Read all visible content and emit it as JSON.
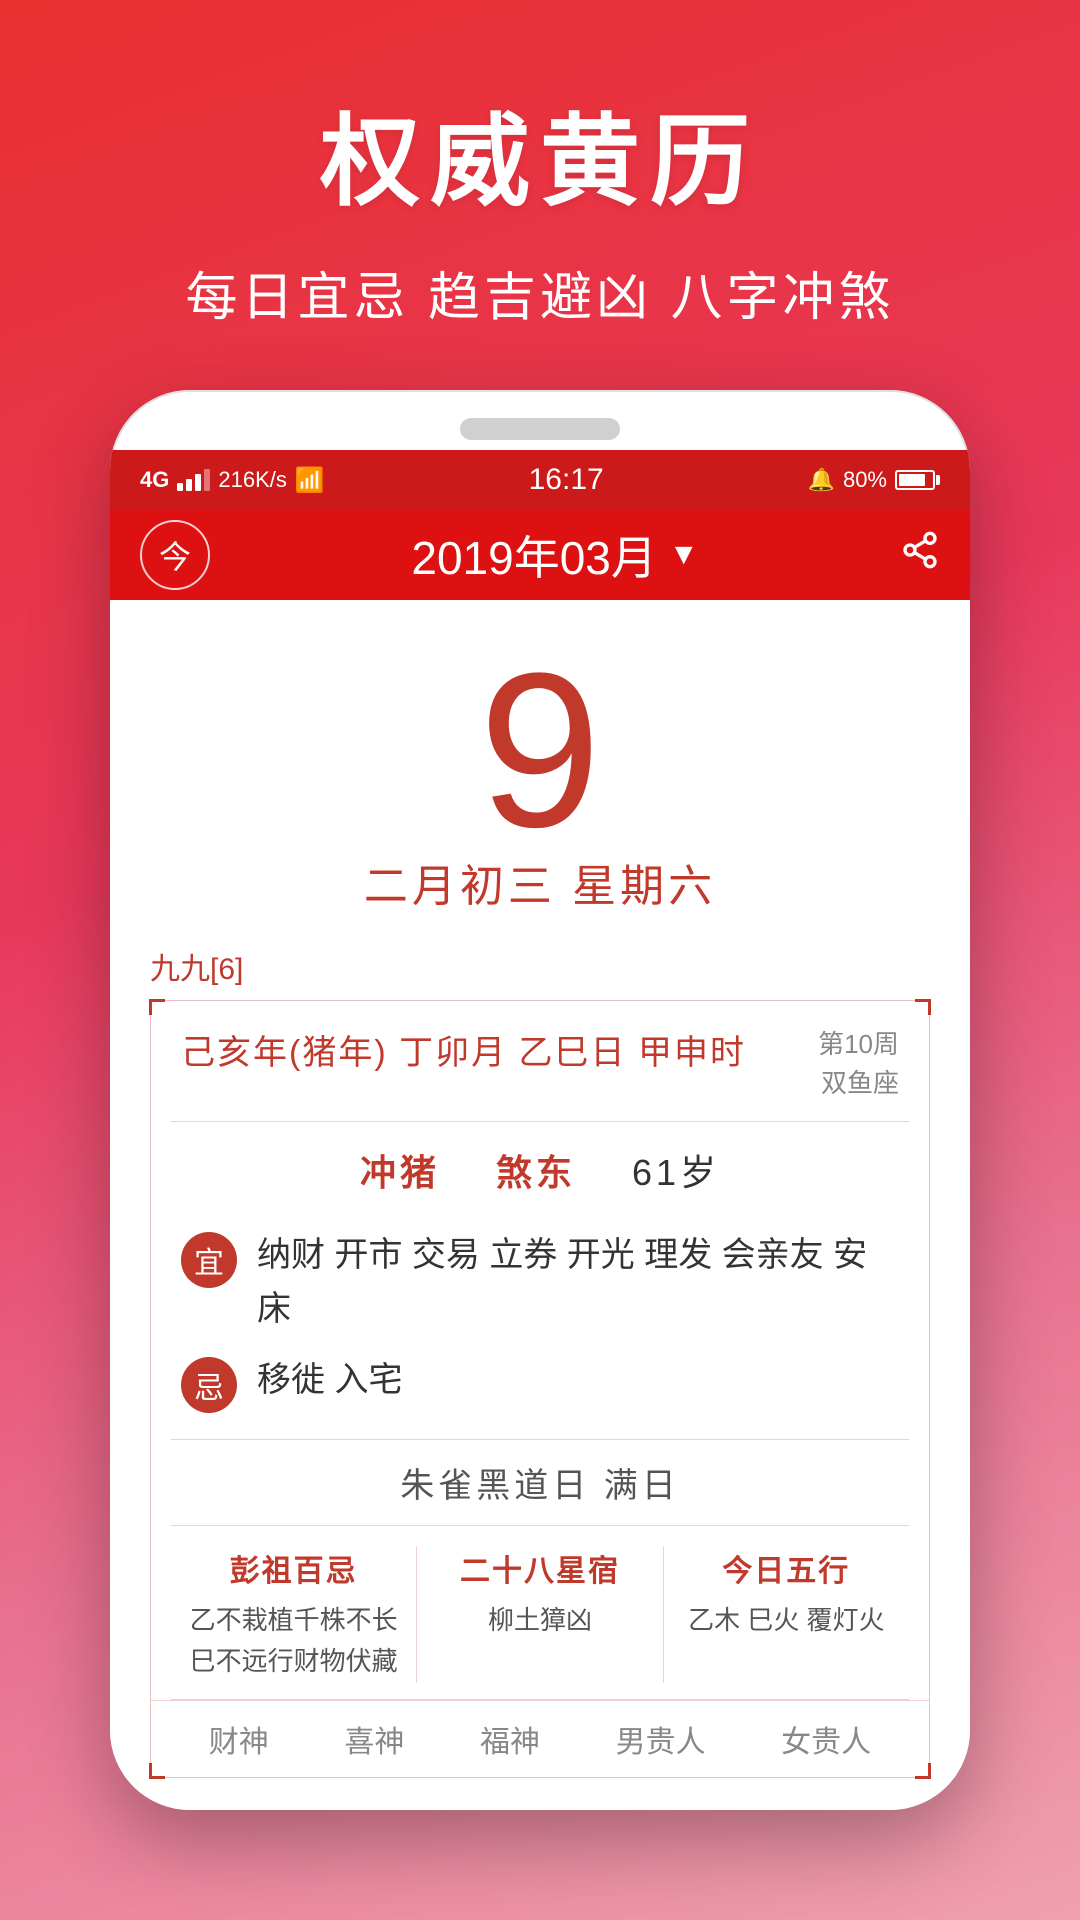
{
  "app": {
    "title": "权威黄历",
    "subtitle": "每日宜忌 趋吉避凶 八字冲煞"
  },
  "status_bar": {
    "signal": "4G",
    "speed": "216K/s",
    "time": "16:17",
    "battery": "80%"
  },
  "header": {
    "today_label": "今",
    "month_title": "2019年03月",
    "dropdown_icon": "▼"
  },
  "date": {
    "day": "9",
    "lunar": "二月初三  星期六"
  },
  "calendar_info": {
    "jiu_label": "九九[6]",
    "ganzhi": "己亥年(猪年) 丁卯月  乙巳日  甲申时",
    "week": "第10周",
    "zodiac": "双鱼座",
    "chong": "冲猪",
    "sha": "煞东",
    "age": "61岁",
    "yi_label": "宜",
    "yi_items": "纳财 开市 交易 立券 开光 理发 会亲友 安床",
    "ji_label": "忌",
    "ji_items": "移徙 入宅",
    "special_day": "朱雀黑道日  满日",
    "pengzu_title": "彭祖百忌",
    "pengzu_content": "乙不栽植千株不长\n巳不远行财物伏藏",
    "xiu_title": "二十八星宿",
    "xiu_content": "柳土獐凶",
    "wuxing_title": "今日五行",
    "wuxing_content": "乙木 巳火 覆灯火",
    "bottom_items": [
      "财神",
      "喜神",
      "福神",
      "男贵人",
      "女贵人"
    ]
  }
}
